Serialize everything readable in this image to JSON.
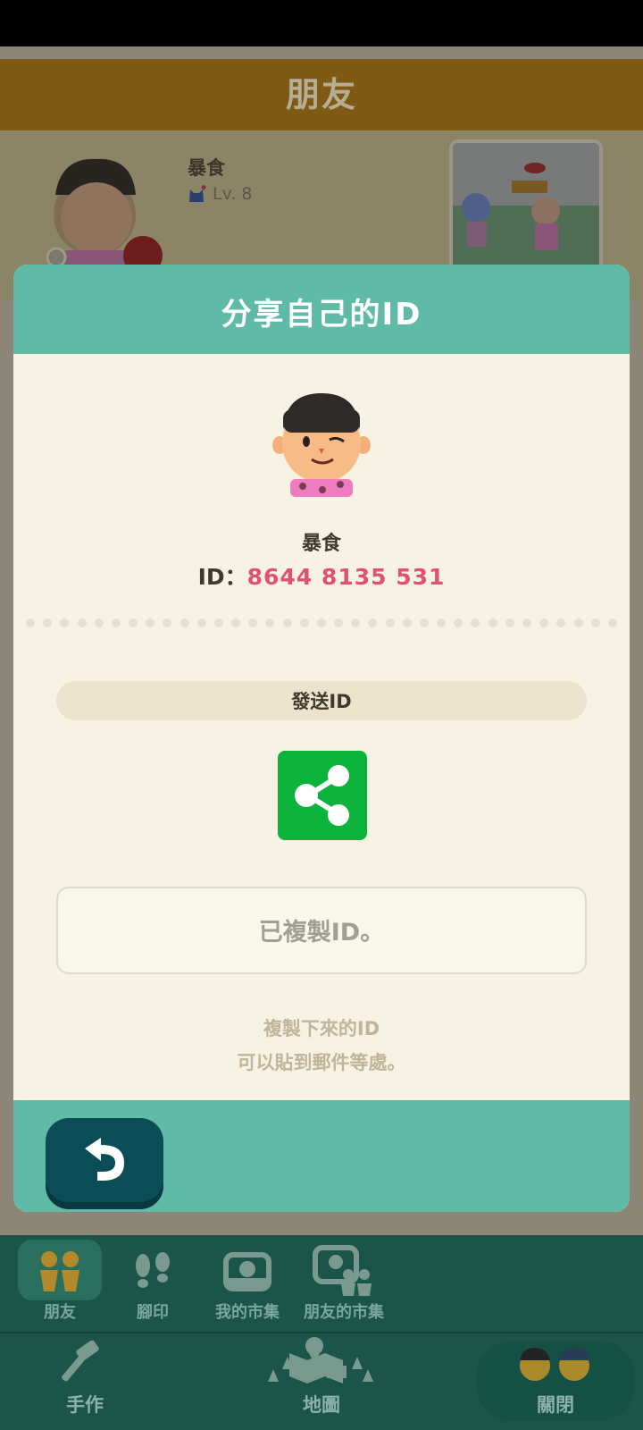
{
  "background": {
    "title": "朋友",
    "profile_name": "暴食",
    "level": "Lv. 8"
  },
  "modal": {
    "title": "分享自己的ID",
    "player_name": "暴食",
    "id_label": "ID：",
    "id_value": "8644 8135 531",
    "send_label": "發送ID",
    "share_icon": "share-icon",
    "copied_message": "已複製ID。",
    "hint_line1": "複製下來的ID",
    "hint_line2": "可以貼到郵件等處。",
    "back_icon": "undo-arrow-icon"
  },
  "nav": {
    "friends": "朋友",
    "footprints": "腳印",
    "my_market": "我的市集",
    "friends_market": "朋友的市集",
    "craft": "手作",
    "map": "地圖",
    "close": "關閉"
  },
  "colors": {
    "header_teal": "#5fbba7",
    "id_pink": "#e0516f",
    "share_green": "#0cb33a",
    "back_button": "#0b4d57"
  }
}
